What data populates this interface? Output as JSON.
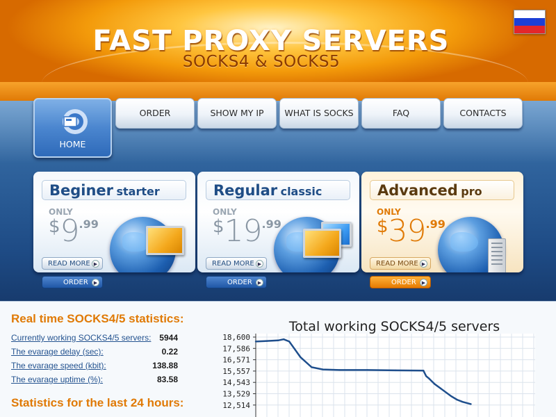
{
  "header": {
    "title": "FAST PROXY SERVERS",
    "subtitle": "SOCKS4 & SOCKS5",
    "language_flag": "russian-flag",
    "colors": {
      "accent_orange": "#e07a06",
      "nav_blue": "#2c5f99"
    }
  },
  "nav": {
    "home": "HOME",
    "order": "ORDER",
    "show_my_ip": "SHOW MY IP",
    "what_is_socks": "WHAT IS SOCKS",
    "faq": "FAQ",
    "contacts": "CONTACTS"
  },
  "plans": [
    {
      "name": "Beginer",
      "tier": "starter",
      "only": "ONLY",
      "currency": "$",
      "price_int": "9",
      "price_cents": ".99",
      "read_more": "READ MORE",
      "order": "ORDER"
    },
    {
      "name": "Regular",
      "tier": "classic",
      "only": "ONLY",
      "currency": "$",
      "price_int": "19",
      "price_cents": ".99",
      "read_more": "READ MORE",
      "order": "ORDER"
    },
    {
      "name": "Advanced",
      "tier": "pro",
      "only": "ONLY",
      "currency": "$",
      "price_int": "39",
      "price_cents": ".99",
      "read_more": "READ MORE",
      "order": "ORDER"
    }
  ],
  "stats": {
    "title": "Real time SOCKS4/5 statistics:",
    "rows": [
      {
        "label": "Currently working SOCKS4/5 servers:",
        "value": "5944"
      },
      {
        "label": "The evarage delay (sec):",
        "value": "0.22"
      },
      {
        "label": "The evarage speed (kbit):",
        "value": "138.88"
      },
      {
        "label": "The evarage uptime (%):",
        "value": "83.58"
      }
    ],
    "last24_title": "Statistics for the last 24 hours:"
  },
  "chart_data": {
    "type": "line",
    "title": "Total working SOCKS4/5 servers",
    "y_ticks": [
      "18,600",
      "17,586",
      "16,571",
      "15,557",
      "14,543",
      "13,529",
      "12,514"
    ],
    "y_tick_values": [
      18600,
      17586,
      16571,
      15557,
      14543,
      13529,
      12514
    ],
    "ylim": [
      12514,
      18600
    ],
    "x": [
      0,
      4,
      8,
      10,
      12,
      14,
      16,
      20,
      24,
      30,
      40,
      50,
      60,
      61,
      62,
      64,
      70,
      72,
      74,
      77
    ],
    "values": [
      18200,
      18250,
      18300,
      18400,
      18200,
      17500,
      16800,
      15900,
      15700,
      15650,
      15650,
      15620,
      15600,
      15100,
      14900,
      14400,
      13300,
      13000,
      12800,
      12600
    ],
    "xlim": [
      0,
      100
    ],
    "grid": true,
    "line_color": "#1e4e8c"
  }
}
